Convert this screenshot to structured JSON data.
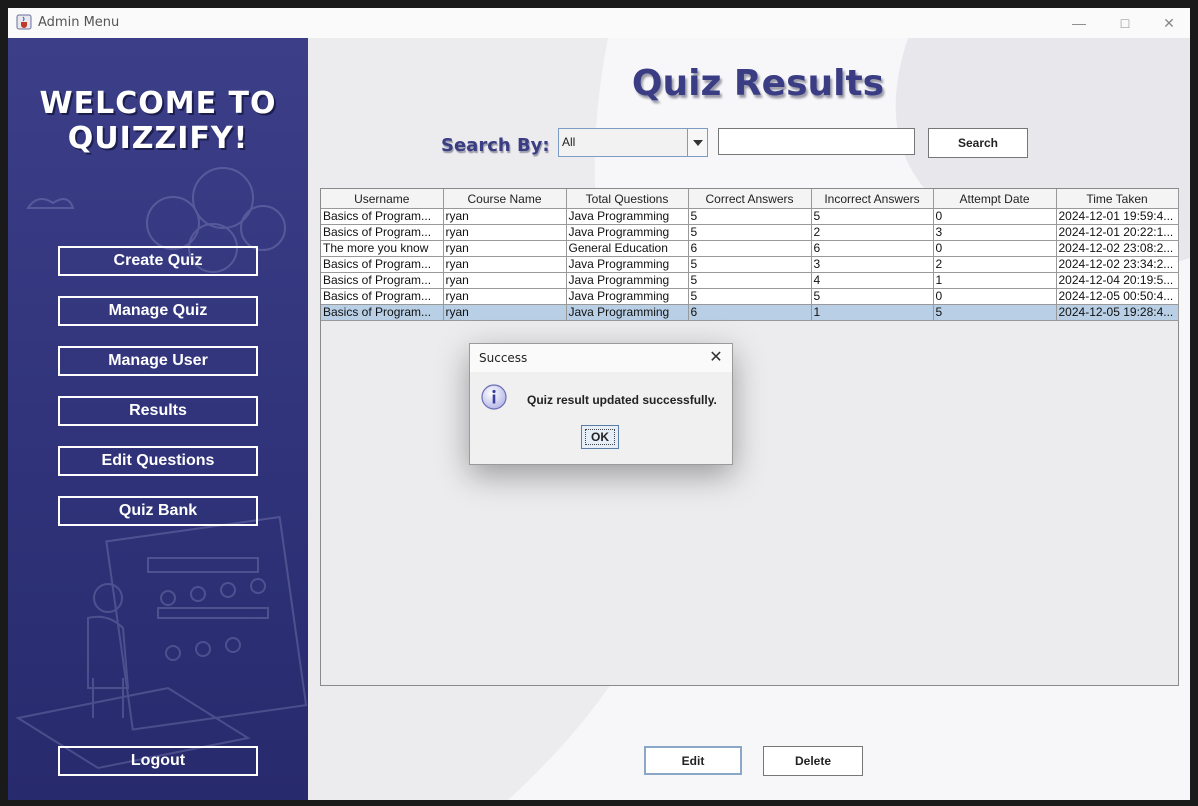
{
  "window": {
    "title": "Admin Menu"
  },
  "sidebar": {
    "welcome_line1": "WELCOME TO",
    "welcome_line2": "QUIZZIFY!",
    "nav": [
      {
        "label": "Create Quiz"
      },
      {
        "label": "Manage Quiz"
      },
      {
        "label": "Manage User"
      },
      {
        "label": "Results"
      },
      {
        "label": "Edit Questions"
      },
      {
        "label": "Quiz Bank"
      }
    ],
    "logout_label": "Logout"
  },
  "main": {
    "title": "Quiz Results",
    "search_label": "Search By:",
    "search_by_selected": "All",
    "search_value": "",
    "search_button": "Search",
    "edit_button": "Edit",
    "delete_button": "Delete"
  },
  "table": {
    "columns": [
      "Username",
      "Course Name",
      "Total Questions",
      "Correct Answers",
      "Incorrect Answers",
      "Attempt Date",
      "Time Taken"
    ],
    "rows": [
      [
        "Basics of Program...",
        "ryan",
        "Java Programming",
        "5",
        "5",
        "0",
        "2024-12-01 19:59:4..."
      ],
      [
        "Basics of Program...",
        "ryan",
        "Java Programming",
        "5",
        "2",
        "3",
        "2024-12-01 20:22:1..."
      ],
      [
        "The more you know",
        "ryan",
        "General Education",
        "6",
        "6",
        "0",
        "2024-12-02 23:08:2..."
      ],
      [
        "Basics of Program...",
        "ryan",
        "Java Programming",
        "5",
        "3",
        "2",
        "2024-12-02 23:34:2..."
      ],
      [
        "Basics of Program...",
        "ryan",
        "Java Programming",
        "5",
        "4",
        "1",
        "2024-12-04 20:19:5..."
      ],
      [
        "Basics of Program...",
        "ryan",
        "Java Programming",
        "5",
        "5",
        "0",
        "2024-12-05 00:50:4..."
      ],
      [
        "Basics of Program...",
        "ryan",
        "Java Programming",
        "6",
        "1",
        "5",
        "2024-12-05 19:28:4..."
      ]
    ],
    "selected_row": 6
  },
  "dialog": {
    "title": "Success",
    "message": "Quiz result updated successfully.",
    "ok_label": "OK",
    "close_glyph": "✕"
  },
  "colors": {
    "sidebar": "#2f3278",
    "accent": "#3a3d84",
    "selection": "#b8cfe5"
  },
  "icons": {
    "app": "java-cup-icon",
    "dialog": "info-icon"
  }
}
